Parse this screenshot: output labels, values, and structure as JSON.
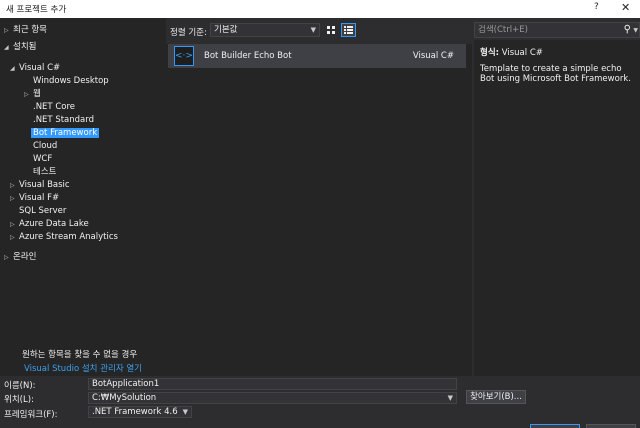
{
  "window": {
    "title": "새 프로젝트 추가",
    "help": "?",
    "close": "✕"
  },
  "tree": {
    "recent": "최근 항목",
    "installed": "설치됨",
    "visual_csharp": "Visual C#",
    "windows_desktop": "Windows Desktop",
    "web": "웹",
    "net_core": ".NET Core",
    "net_standard": ".NET Standard",
    "bot_framework": "Bot Framework",
    "cloud": "Cloud",
    "wcf": "WCF",
    "test": "테스트",
    "visual_basic": "Visual Basic",
    "visual_fsharp": "Visual F#",
    "sql_server": "SQL Server",
    "azure_data_lake": "Azure Data Lake",
    "azure_stream_analytics": "Azure Stream Analytics",
    "online": "온라인"
  },
  "hint": {
    "text": "원하는 항목을 찾을 수 없을 경우",
    "link": "Visual Studio 설치 관리자 열기"
  },
  "sort": {
    "label": "정렬 기준:",
    "value": "기본값"
  },
  "templates": [
    {
      "name": "Bot Builder Echo Bot",
      "lang": "Visual C#",
      "icon": "<·>"
    }
  ],
  "search": {
    "placeholder": "검색(Ctrl+E)"
  },
  "details": {
    "type_key": "형식:",
    "type_value": "Visual C#",
    "description": "Template to create a simple echo Bot using Microsoft Bot Framework."
  },
  "form": {
    "name_label": "이름(N):",
    "name_value": "BotApplication1",
    "location_label": "위치(L):",
    "location_value": "C:₩MySolution",
    "framework_label": "프레임워크(F):",
    "framework_value": ".NET Framework 4.6",
    "browse_label": "찾아보기(B)..."
  },
  "colors": {
    "accent": "#3399ff",
    "background": "#2d2d30",
    "panel": "#252526"
  }
}
